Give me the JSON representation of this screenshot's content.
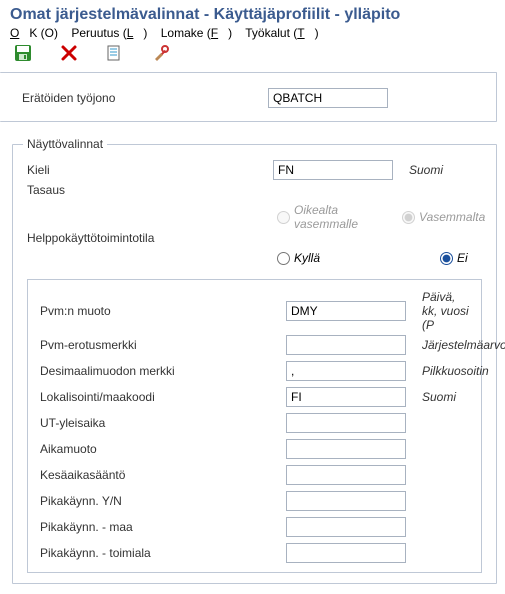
{
  "title": "Omat järjestelmävalinnat - Käyttäjäprofiilit - ylläpito",
  "menubar": {
    "ok": "OK (O)",
    "peruutus": "Peruutus (L)",
    "lomake": "Lomake (F)",
    "tyokalut": "Työkalut (T)"
  },
  "top_panel": {
    "rows": [
      {
        "label": "Erätöiden työjono",
        "value": "QBATCH",
        "desc": ""
      }
    ]
  },
  "display_panel": {
    "legend": "Näyttövalinnat",
    "rows": [
      {
        "label": "Kieli",
        "value": "FN",
        "desc": "Suomi"
      }
    ],
    "tasaus_label": "Tasaus",
    "tasaus_options": {
      "rtl": "Oikealta vasemmalle",
      "ltr": "Vasemmalta"
    },
    "help_label": "Helppokäyttötoimintotila",
    "help_options": {
      "yes": "Kyllä",
      "no": "Ei"
    },
    "inner_rows": [
      {
        "label": "Pvm:n muoto",
        "value": "DMY",
        "desc": "Päivä, kk, vuosi (P"
      },
      {
        "label": "Pvm-erotusmerkki",
        "value": "",
        "desc": "Järjestelmäarvo"
      },
      {
        "label": "Desimaalimuodon merkki",
        "value": ",",
        "desc": "Pilkkuosoitin"
      },
      {
        "label": "Lokalisointi/maakoodi",
        "value": "FI",
        "desc": "Suomi"
      },
      {
        "label": "UT-yleisaika",
        "value": "",
        "desc": ""
      },
      {
        "label": "Aikamuoto",
        "value": "",
        "desc": ""
      },
      {
        "label": "Kesäaikasääntö",
        "value": "",
        "desc": ""
      },
      {
        "label": "Pikakäynn. Y/N",
        "value": "",
        "desc": ""
      },
      {
        "label": "Pikakäynn. - maa",
        "value": "",
        "desc": ""
      },
      {
        "label": "Pikakäynn. - toimiala",
        "value": "",
        "desc": ""
      }
    ]
  }
}
